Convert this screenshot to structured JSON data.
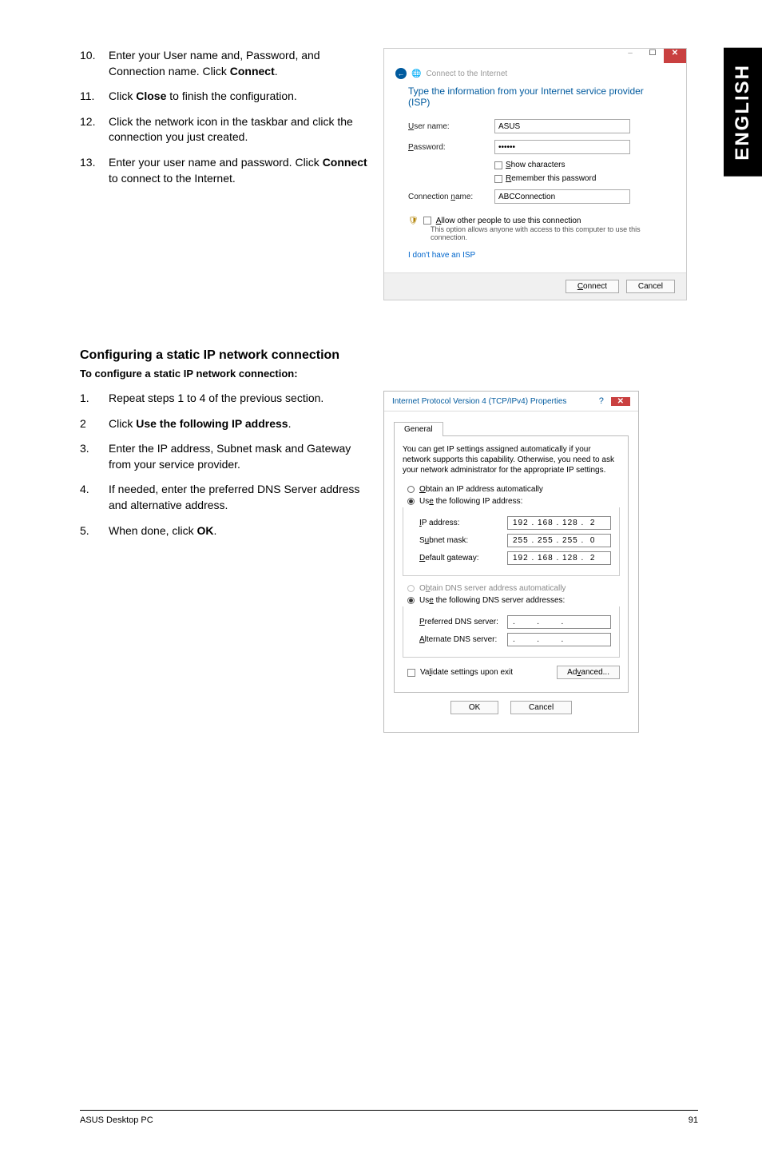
{
  "sideTab": "ENGLISH",
  "steps1": [
    {
      "n": "10.",
      "pre": "Enter your User name and, Password, and Connection name. Click ",
      "bold": "Connect",
      "post": "."
    },
    {
      "n": "11.",
      "pre": "Click ",
      "bold": "Close",
      "post": " to finish the configuration."
    },
    {
      "n": "12.",
      "pre": "Click the network icon in the taskbar and click the connection you just created.",
      "bold": "",
      "post": ""
    },
    {
      "n": "13.",
      "pre": "Enter your user name and password. Click ",
      "bold": "Connect",
      "post": " to connect to the Internet."
    }
  ],
  "dialog1": {
    "backLabel": "Connect to the Internet",
    "heading": "Type the information from your Internet service provider (ISP)",
    "userNameLabel": "User name:",
    "userNameValue": "ASUS",
    "passwordLabel": "Password:",
    "passwordValue": "••••••",
    "showChars": "Show characters",
    "remember": "Remember this password",
    "connNameLabel": "Connection name:",
    "connNameValue": "ABCConnection",
    "allowLabel": "Allow other people to use this connection",
    "allowSub": "This option allows anyone with access to this computer to use this connection.",
    "noIspLink": "I don't have an ISP",
    "connectBtn": "Connect",
    "cancelBtn": "Cancel"
  },
  "section2Heading": "Configuring a static IP network connection",
  "section2Sub": "To configure a static IP network connection:",
  "steps2": [
    {
      "n": "1.",
      "txt": "Repeat steps 1 to 4 of the previous section."
    },
    {
      "n": "2",
      "pre": "Click ",
      "bold": "Use the following IP address",
      "post": "."
    },
    {
      "n": "3.",
      "txt": "Enter the IP address, Subnet mask and Gateway from your service provider."
    },
    {
      "n": "4.",
      "txt": "If needed, enter the preferred DNS Server address and alternative address."
    },
    {
      "n": "5.",
      "pre": "When done, click ",
      "bold": "OK",
      "post": "."
    }
  ],
  "dialog2": {
    "title": "Internet Protocol Version 4 (TCP/IPv4) Properties",
    "tab": "General",
    "desc": "You can get IP settings assigned automatically if your network supports this capability. Otherwise, you need to ask your network administrator for the appropriate IP settings.",
    "radioAuto": "Obtain an IP address automatically",
    "radioUse": "Use the following IP address:",
    "ipLabel": "IP address:",
    "ipValue": "192 . 168 . 128 .  2",
    "maskLabel": "Subnet mask:",
    "maskValue": "255 . 255 . 255 .  0",
    "gwLabel": "Default gateway:",
    "gwValue": "192 . 168 . 128 .  2",
    "radioDnsAuto": "Obtain DNS server address automatically",
    "radioDnsUse": "Use the following DNS server addresses:",
    "prefDnsLabel": "Preferred DNS server:",
    "prefDnsValue": ".       .       .",
    "altDnsLabel": "Alternate DNS server:",
    "altDnsValue": ".       .       .",
    "validate": "Validate settings upon exit",
    "advBtn": "Advanced...",
    "okBtn": "OK",
    "cancelBtn": "Cancel"
  },
  "footerLeft": "ASUS Desktop PC",
  "footerRight": "91"
}
